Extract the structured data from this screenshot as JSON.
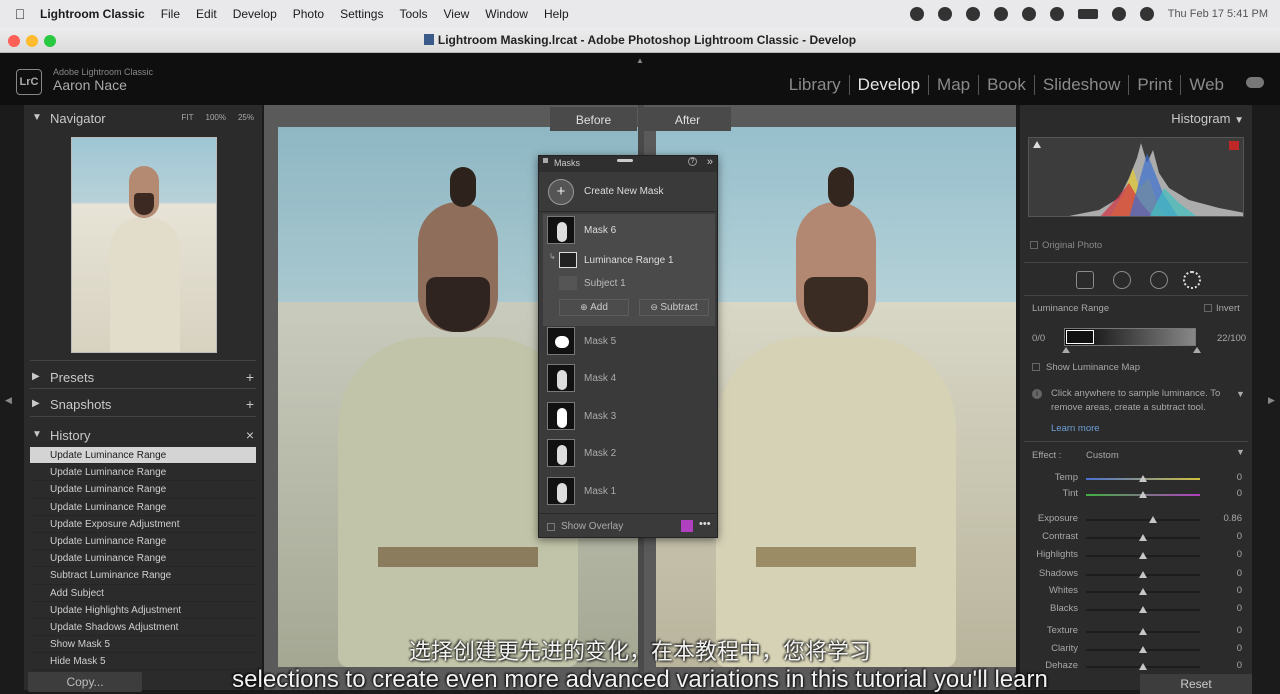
{
  "menubar": {
    "app_name": "Lightroom Classic",
    "items": [
      "File",
      "Edit",
      "Develop",
      "Photo",
      "Settings",
      "Tools",
      "View",
      "Window",
      "Help"
    ],
    "datetime": "Thu Feb 17  5:41 PM"
  },
  "window": {
    "title": "Lightroom Masking.lrcat - Adobe Photoshop Lightroom Classic - Develop"
  },
  "identity": {
    "badge": "LrC",
    "line1": "Adobe Lightroom Classic",
    "line2": "Aaron Nace"
  },
  "modules": [
    "Library",
    "Develop",
    "Map",
    "Book",
    "Slideshow",
    "Print",
    "Web"
  ],
  "active_module": "Develop",
  "left_panel": {
    "navigator": {
      "title": "Navigator",
      "zoom": [
        "FIT",
        "100%",
        "25%"
      ]
    },
    "presets": {
      "title": "Presets",
      "action": "+"
    },
    "snapshots": {
      "title": "Snapshots",
      "action": "+"
    },
    "history": {
      "title": "History",
      "action": "×",
      "items": [
        "Update Luminance Range",
        "Update Luminance Range",
        "Update Luminance Range",
        "Update Luminance Range",
        "Update Exposure Adjustment",
        "Update Luminance Range",
        "Update Luminance Range",
        "Subtract Luminance Range",
        "Add Subject",
        "Update Highlights Adjustment",
        "Update Shadows Adjustment",
        "Show Mask 5",
        "Hide Mask 5"
      ]
    },
    "copy_button": "Copy..."
  },
  "compare": {
    "before": "Before",
    "after": "After"
  },
  "masks_panel": {
    "title": "Masks",
    "create": "Create New Mask",
    "active_mask": "Mask 6",
    "component_1": "Luminance Range 1",
    "component_2": "Subject 1",
    "add": "Add",
    "subtract": "Subtract",
    "masks": [
      "Mask 5",
      "Mask 4",
      "Mask 3",
      "Mask 2",
      "Mask 1"
    ],
    "show_overlay": "Show Overlay",
    "overlay_color": "#b040c0"
  },
  "right_panel": {
    "histogram_title": "Histogram",
    "original_photo": "Original Photo",
    "section": "Luminance Range",
    "invert": "Invert",
    "range_low": "0/0",
    "range_high": "22/100",
    "show_map": "Show Luminance Map",
    "hint": "Click anywhere to sample luminance. To remove areas, create a subtract tool.",
    "learn_more": "Learn more",
    "effect_label": "Effect :",
    "effect_value": "Custom",
    "sliders": [
      {
        "label": "Temp",
        "value": "0",
        "pos": 0.5
      },
      {
        "label": "Tint",
        "value": "0",
        "pos": 0.5
      },
      {
        "label": "Exposure",
        "value": "0.86",
        "pos": 0.59
      },
      {
        "label": "Contrast",
        "value": "0",
        "pos": 0.5
      },
      {
        "label": "Highlights",
        "value": "0",
        "pos": 0.5
      },
      {
        "label": "Shadows",
        "value": "0",
        "pos": 0.5
      },
      {
        "label": "Whites",
        "value": "0",
        "pos": 0.5
      },
      {
        "label": "Blacks",
        "value": "0",
        "pos": 0.5
      },
      {
        "label": "Texture",
        "value": "0",
        "pos": 0.5
      },
      {
        "label": "Clarity",
        "value": "0",
        "pos": 0.5
      },
      {
        "label": "Dehaze",
        "value": "0",
        "pos": 0.5
      }
    ],
    "reset": "Reset"
  },
  "subtitles": {
    "cn": "选择创建更先进的变化，在本教程中，您将学习",
    "en": "selections to create even more advanced variations in this tutorial you'll learn"
  }
}
